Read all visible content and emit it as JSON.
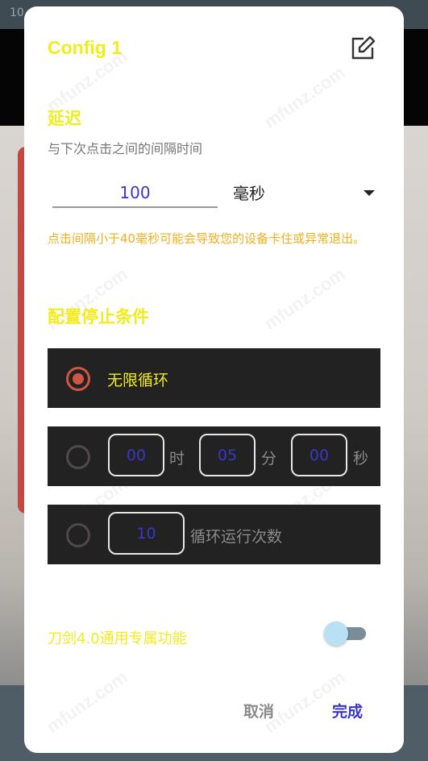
{
  "background": {
    "status_text": "10"
  },
  "dialog": {
    "title": "Config 1",
    "watermark": "mfunz.com",
    "delay": {
      "heading": "延迟",
      "subtitle": "与下次点击之间的间隔时间",
      "value": "100",
      "unit": "毫秒",
      "warning": "点击间隔小于40毫秒可能会导致您的设备卡住或异常退出。"
    },
    "stop_conditions": {
      "heading": "配置停止条件",
      "infinite_label": "无限循环",
      "timer": {
        "hours": "00",
        "hours_label": "时",
        "minutes": "05",
        "minutes_label": "分",
        "seconds": "00",
        "seconds_label": "秒"
      },
      "cycles": {
        "value": "10",
        "label": "循环运行次数"
      },
      "selected": "infinite"
    },
    "feature": {
      "label": "刀剑4.0通用专属功能",
      "enabled": false
    },
    "buttons": {
      "cancel": "取消",
      "done": "完成"
    }
  },
  "colors": {
    "accent_yellow": "#f2ec1d",
    "warning_orange": "#f2b01d",
    "value_blue": "#3a37c8",
    "radio_red": "#cf5545",
    "row_dark": "#222222"
  },
  "icons": {
    "edit": "edit-icon",
    "dropdown": "dropdown-arrow-icon"
  }
}
